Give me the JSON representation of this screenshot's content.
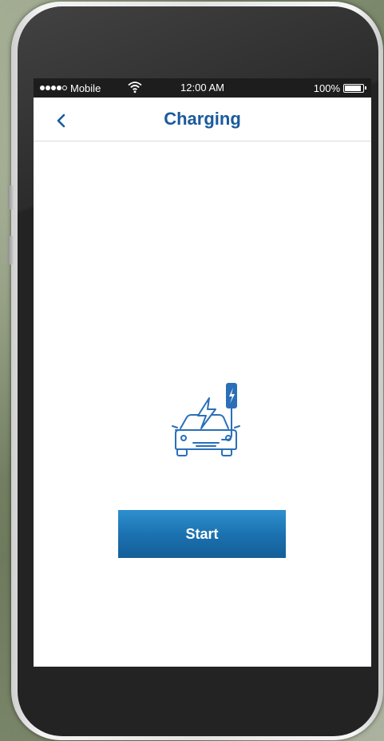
{
  "status_bar": {
    "carrier": "Mobile",
    "time": "12:00 AM",
    "battery_percent": "100%",
    "battery_level": 1.0,
    "signal_bars_filled": 4,
    "signal_bars_total": 5
  },
  "nav": {
    "back_label": "<",
    "title": "Charging"
  },
  "main": {
    "illustration_icon": "ev-charging-car-icon",
    "start_label": "Start"
  },
  "colors": {
    "accent": "#1a5a9c",
    "button": "#1a70ae"
  }
}
